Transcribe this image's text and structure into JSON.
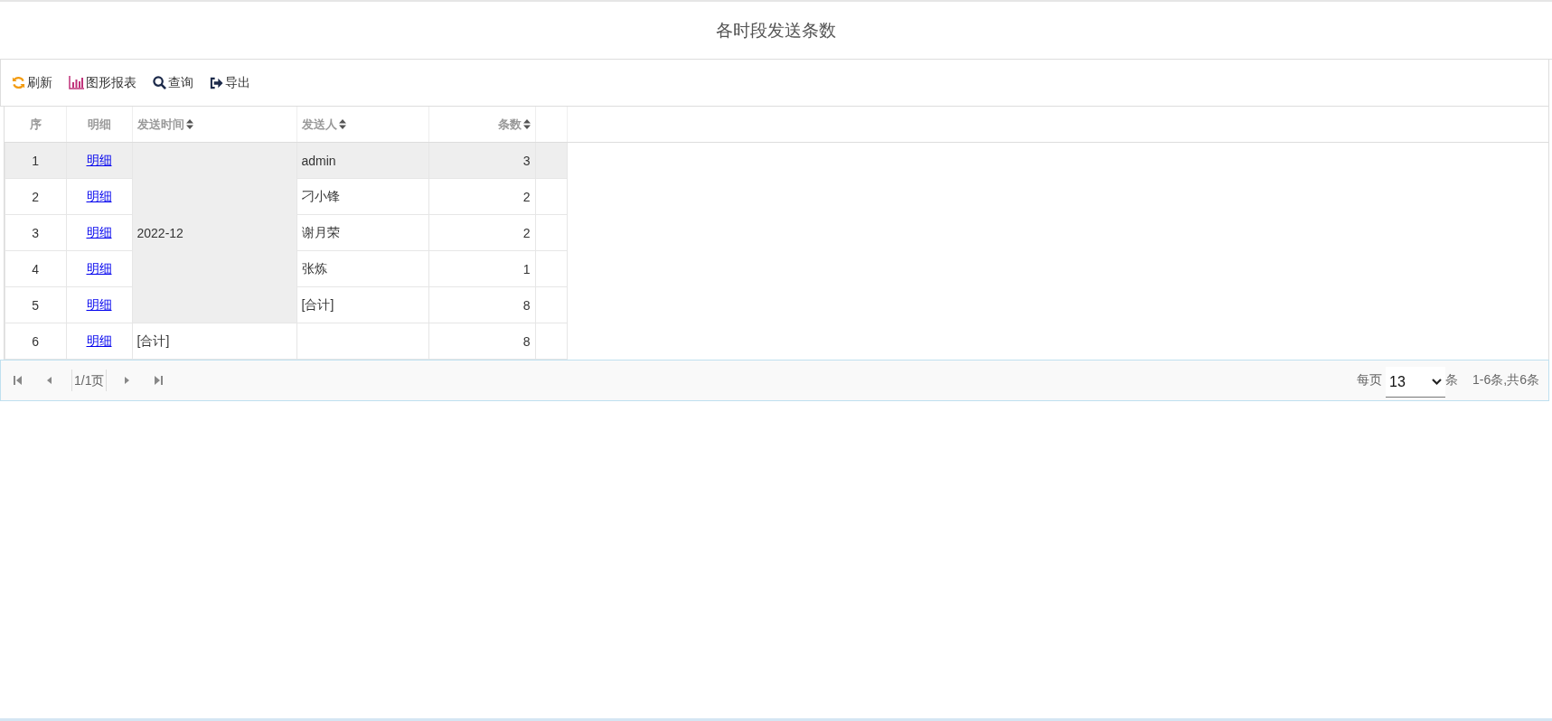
{
  "title": "各时段发送条数",
  "toolbar": [
    {
      "kind": "refresh",
      "label": "刷新"
    },
    {
      "kind": "chart",
      "label": "图形报表"
    },
    {
      "kind": "search",
      "label": "查询"
    },
    {
      "kind": "export",
      "label": "导出"
    }
  ],
  "table": {
    "columns": [
      {
        "label": "序",
        "sortable": false
      },
      {
        "label": "明细",
        "sortable": false
      },
      {
        "label": "发送时间",
        "sortable": true
      },
      {
        "label": "发送人",
        "sortable": true
      },
      {
        "label": "条数",
        "sortable": true
      }
    ],
    "groups": [
      {
        "time": "2022-12",
        "rows": [
          {
            "index": "1",
            "link": "明细",
            "sender": "admin",
            "count": "3",
            "selected": true
          },
          {
            "index": "2",
            "link": "明细",
            "sender": "刁小锋",
            "count": "2",
            "selected": false
          },
          {
            "index": "3",
            "link": "明细",
            "sender": "谢月荣",
            "count": "2",
            "selected": false
          },
          {
            "index": "4",
            "link": "明细",
            "sender": "张炼",
            "count": "1",
            "selected": false
          },
          {
            "index": "5",
            "link": "明细",
            "sender": "[合计]",
            "count": "8",
            "selected": false
          }
        ]
      },
      {
        "time": "[合计]",
        "rows": [
          {
            "index": "6",
            "link": "明细",
            "sender": "",
            "count": "8",
            "selected": false
          }
        ]
      }
    ]
  },
  "pager": {
    "page": "1/1页",
    "per_page_label": "每页",
    "per_page": "13",
    "per_page_unit": "条",
    "summary": "1-6条,共6条"
  }
}
